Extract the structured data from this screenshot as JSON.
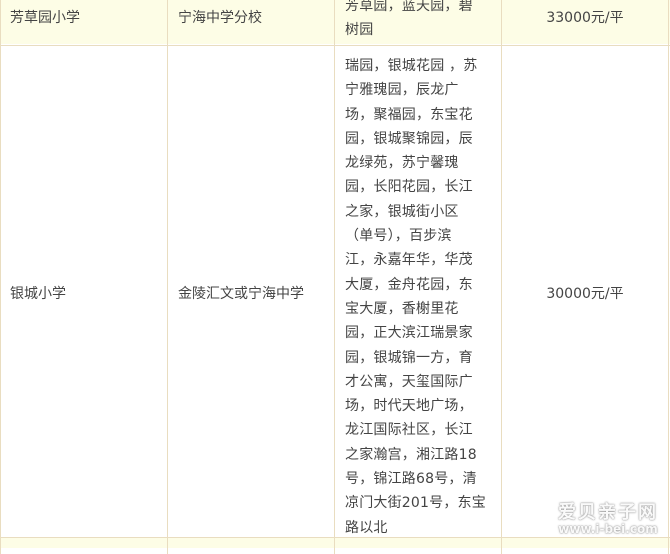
{
  "table": {
    "rows": [
      {
        "school": "芳草园小学",
        "middle_school": "宁海中学分校",
        "area": [
          "芳草园，蓝天园，碧",
          "树园"
        ],
        "price": "33000元/平"
      },
      {
        "school": "银城小学",
        "middle_school": "金陵汇文或宁海中学",
        "area": [
          "瑞园，银城花园 ，苏",
          "宁雅瑰园，辰龙广",
          "场，聚福园，东宝花",
          "园，银城聚锦园，辰",
          "龙绿苑，苏宁馨瑰",
          "园，长阳花园，长江",
          "之家，银城街小区",
          "（单号），百步滨",
          "江，永嘉年华，华茂",
          "大厦，金舟花园，东",
          "宝大厦，香榭里花",
          "园，正大滨江瑞景家",
          "园，银城锦一方，育",
          "才公寓，天玺国际广",
          "场，时代天地广场，",
          "龙江国际社区，长江",
          "之家瀚宫，湘江路18",
          "号，锦江路68号，清",
          "凉门大街201号，东宝",
          "路以北"
        ],
        "price": "30000元/平"
      }
    ]
  },
  "watermark": {
    "main": "爱贝亲子网",
    "url": "www.i-bei.com"
  },
  "colors": {
    "row_highlight": "#fdfde6",
    "border": "#e9ddc0",
    "text": "#444444"
  }
}
